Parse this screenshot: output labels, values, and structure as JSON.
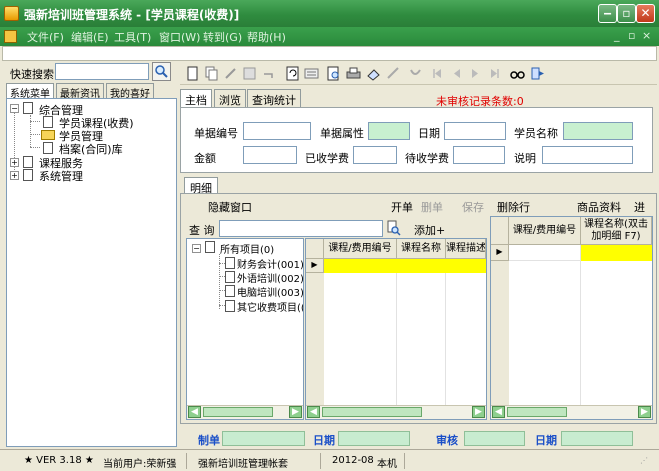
{
  "window": {
    "title": "强新培训班管理系统 - [学员课程(收费)]"
  },
  "menu": [
    "文件(F)",
    "编辑(E)",
    "工具(T)",
    "窗口(W)",
    "转到(G)",
    "帮助(H)"
  ],
  "mdi_controls": [
    "_",
    "▫",
    "×"
  ],
  "quick_search": {
    "label": "快速搜索",
    "value": ""
  },
  "left_tabs": [
    "系统菜单",
    "最新资讯",
    "我的喜好"
  ],
  "left_tree": {
    "root": "综合管理",
    "children": [
      "学员课程(收费)",
      "学员管理",
      "档案(合同)库"
    ],
    "others": [
      "课程服务",
      "系统管理"
    ]
  },
  "main_tabs": [
    "主档",
    "浏览",
    "查询统计"
  ],
  "unaudited": "未审核记录条数:0",
  "form": {
    "doc_no": "单据编号",
    "doc_attr": "单据属性",
    "date": "日期",
    "student": "学员名称",
    "amount": "金额",
    "received": "已收学费",
    "pending": "待收学费",
    "remark": "说明"
  },
  "detail": {
    "tab": "明细",
    "hide_window": "隐藏窗口",
    "actions": {
      "open": "开单",
      "del": "删单",
      "save": "保存",
      "delrow": "删除行",
      "goods": "商品资料",
      "more": "进"
    },
    "query_label": "查 询",
    "add_label": "添加+",
    "item_tree": {
      "root": "所有项目(0)",
      "items": [
        "财务会计(001)",
        "外语培训(002)",
        "电脑培训(003)",
        "其它收费项目(("
      ]
    },
    "grid1_headers": [
      "课程/费用编号",
      "课程名称",
      "课程描述"
    ],
    "grid2_headers": [
      "课程/费用编号",
      "课程名称(双击加明细 F7)"
    ]
  },
  "summary": {
    "maker": "制单",
    "date1": "日期",
    "auditor": "审核",
    "date2": "日期"
  },
  "status": {
    "version": "★ VER 3.18 ★",
    "current_user": "当前用户:荣新强",
    "account": "强新培训班管理帐套",
    "period": "2012-08",
    "location": "本机"
  },
  "colors": {
    "title_green": "#2f8c3f",
    "field_green": "#c8f0d0",
    "alert_red": "#e00000",
    "selected_row": "#ffff00"
  }
}
